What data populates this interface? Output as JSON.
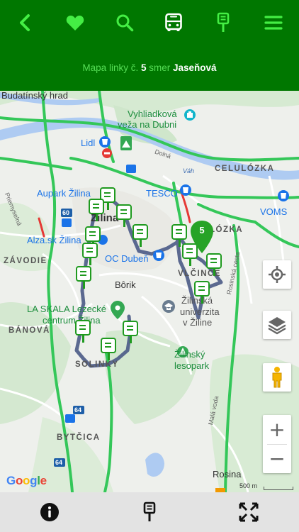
{
  "colors": {
    "header": "#007700",
    "accent_icon": "#44ee44",
    "route": "#4a5a86",
    "stop": "#1f9a1f",
    "pin": "#27a327"
  },
  "nav": {
    "icons": [
      "chevron-left-icon",
      "heart-icon",
      "search-icon",
      "bus-icon",
      "bus-stop-icon",
      "menu-icon"
    ]
  },
  "header": {
    "prefix": "Mapa linky č.",
    "line_number": "5",
    "direction_word": "smer",
    "destination": "Jaseňová"
  },
  "map": {
    "labels": {
      "budatinsky_hrad": "Budatínský hrad",
      "vyhliadkova_1": "Vyhliadková",
      "vyhliadkova_2": "veža na Dubni",
      "lidl": "Lidl",
      "dolna": "Dolná",
      "vah": "Váh",
      "celulozka": "CELULÓZKA",
      "aupark": "Aupark Žilina",
      "tesco": "TESCO",
      "voms": "VOMS",
      "zilina": "Žilina",
      "lozka": "LÓZKA",
      "alza": "Alza.sk Žilina",
      "zavodie": "ZÁVODIE",
      "oc_duben": "OC Dubeň",
      "vlcince": "VLČINCE",
      "borik": "Bôrik",
      "uni_1": "Žilinská",
      "uni_2": "univerzita",
      "uni_3": "v Žiline",
      "la_skala_1": "LA SKALA Lezecké",
      "la_skala_2": "centrum Žilina",
      "banova": "BÁNOVÁ",
      "lesopark_1": "Žilinský",
      "lesopark_2": "lesopark",
      "solinky": "SOLINKY",
      "bytcica": "BYTČICA",
      "rosina": "Rosina",
      "pomnenska": "Priemyselná",
      "rosinska": "Rosinská cesta",
      "mala_voda": "Malá voda",
      "road_60": "60",
      "road_64a": "64",
      "road_64b": "64"
    },
    "pin_label": "5",
    "google": "Google",
    "scale": "500 m",
    "controls": [
      "my-location-icon",
      "layers-icon",
      "pegman-icon"
    ],
    "zoom_in": "+",
    "zoom_out": "−"
  },
  "bottom": {
    "icons": [
      "info-icon",
      "bus-stop-icon",
      "fullscreen-icon"
    ]
  }
}
